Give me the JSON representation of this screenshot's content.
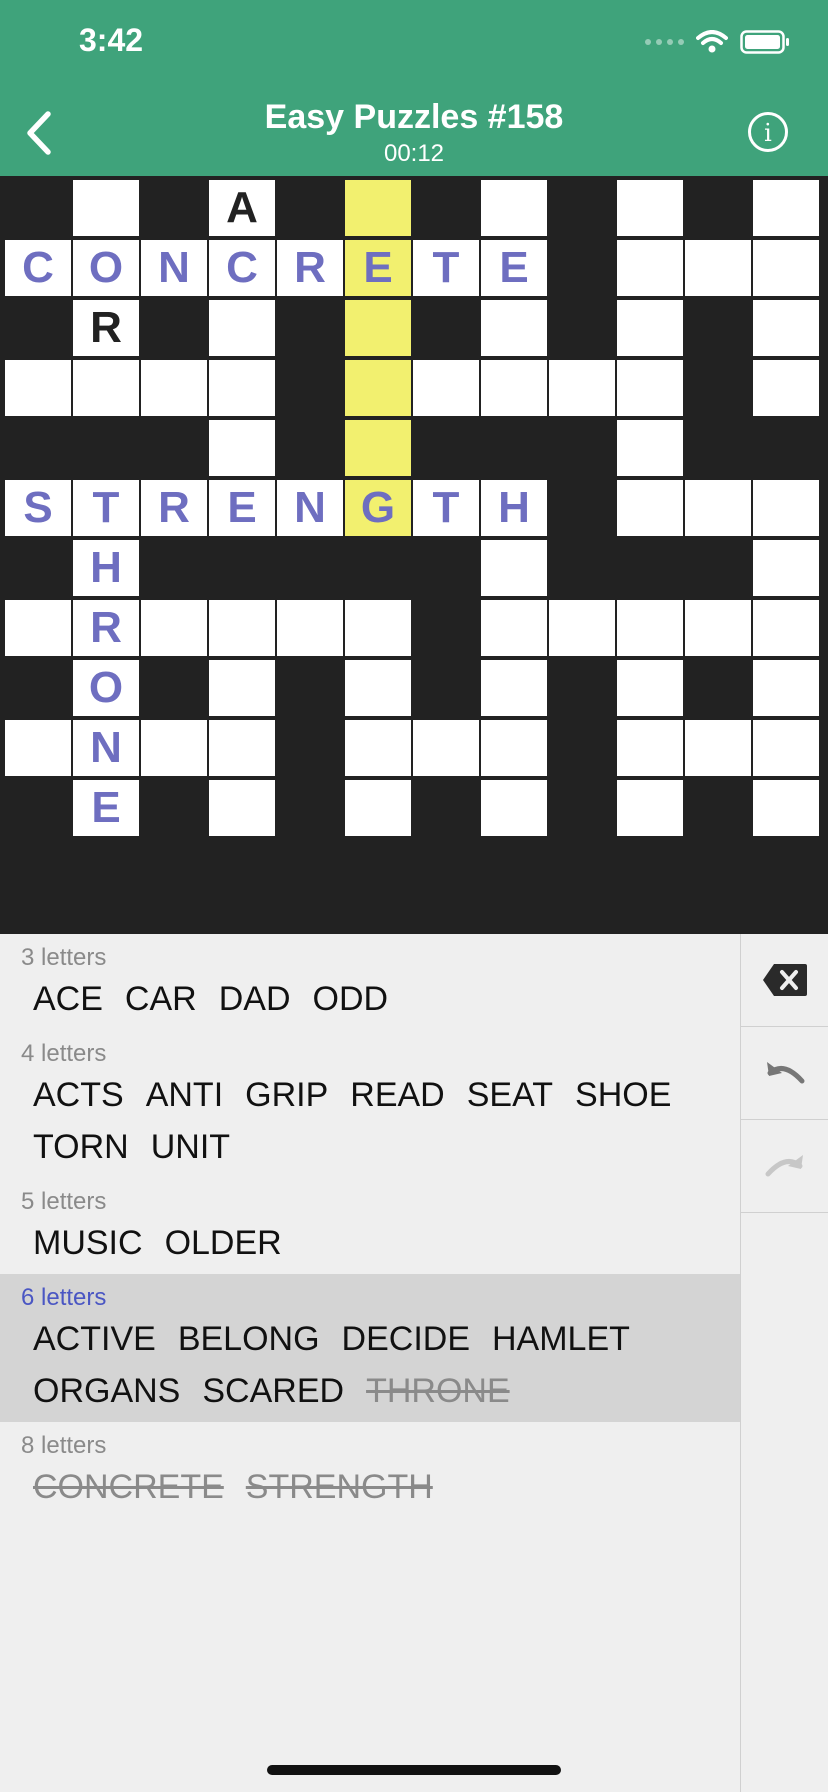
{
  "status_bar": {
    "time": "3:42"
  },
  "header": {
    "title": "Easy Puzzles #158",
    "timer": "00:12"
  },
  "grid": {
    "rows": [
      [
        ".",
        "_",
        ".",
        "A",
        ".",
        "*",
        ".",
        "_",
        ".",
        "_",
        ".",
        "_"
      ],
      [
        "C",
        "O",
        "N",
        "C",
        "R",
        "E",
        "T",
        "E",
        ".",
        "_",
        "_",
        "_"
      ],
      [
        ".",
        "R",
        ".",
        "_",
        ".",
        "*",
        ".",
        "_",
        ".",
        "_",
        ".",
        "_"
      ],
      [
        "_",
        "_",
        "_",
        "_",
        ".",
        "*",
        "_",
        "_",
        "_",
        "_",
        ".",
        "_"
      ],
      [
        ".",
        ".",
        ".",
        "_",
        ".",
        "*",
        ".",
        ".",
        ".",
        "_",
        ".",
        "."
      ],
      [
        "S",
        "T",
        "R",
        "E",
        "N",
        "G",
        "T",
        "H",
        ".",
        "_",
        "_",
        "_"
      ],
      [
        ".",
        "H",
        ".",
        ".",
        ".",
        ".",
        ".",
        "_",
        ".",
        ".",
        ".",
        "_"
      ],
      [
        "_",
        "R",
        "_",
        "_",
        "_",
        "_",
        ".",
        "_",
        "_",
        "_",
        "_",
        "_"
      ],
      [
        ".",
        "O",
        ".",
        "_",
        ".",
        "_",
        ".",
        "_",
        ".",
        "_",
        ".",
        "_"
      ],
      [
        "_",
        "N",
        "_",
        "_",
        ".",
        "_",
        "_",
        "_",
        ".",
        "_",
        "_",
        "_"
      ],
      [
        ".",
        "E",
        ".",
        "_",
        ".",
        "_",
        ".",
        "_",
        ".",
        "_",
        ".",
        "_"
      ]
    ],
    "given_letters": [
      "0,3",
      "2,1"
    ],
    "highlight_color": "#f2f06f",
    "letter_color": "#6e6ec0"
  },
  "word_groups": [
    {
      "label": "3 letters",
      "lines": [
        [
          {
            "w": "ACE"
          },
          {
            "w": "CAR"
          },
          {
            "w": "DAD"
          },
          {
            "w": "ODD"
          }
        ]
      ]
    },
    {
      "label": "4 letters",
      "lines": [
        [
          {
            "w": "ACTS"
          },
          {
            "w": "ANTI"
          },
          {
            "w": "GRIP"
          },
          {
            "w": "READ"
          },
          {
            "w": "SEAT"
          },
          {
            "w": "SHOE"
          }
        ],
        [
          {
            "w": "TORN"
          },
          {
            "w": "UNIT"
          }
        ]
      ]
    },
    {
      "label": "5 letters",
      "lines": [
        [
          {
            "w": "MUSIC"
          },
          {
            "w": "OLDER"
          }
        ]
      ]
    },
    {
      "label": "6 letters",
      "active": true,
      "lines": [
        [
          {
            "w": "ACTIVE"
          },
          {
            "w": "BELONG"
          },
          {
            "w": "DECIDE"
          },
          {
            "w": "HAMLET"
          }
        ],
        [
          {
            "w": "ORGANS"
          },
          {
            "w": "SCARED"
          },
          {
            "w": "THRONE",
            "used": true
          }
        ]
      ]
    },
    {
      "label": "8 letters",
      "lines": [
        [
          {
            "w": "CONCRETE",
            "used": true
          },
          {
            "w": "STRENGTH",
            "used": true
          }
        ]
      ]
    }
  ],
  "side_buttons": [
    {
      "name": "delete-button",
      "icon": "backspace-x-icon"
    },
    {
      "name": "undo-button",
      "icon": "undo-icon"
    },
    {
      "name": "redo-button",
      "icon": "redo-icon",
      "disabled": true
    }
  ],
  "colors": {
    "header": "#3fa37b",
    "active_group": "#d4d4d4",
    "active_label": "#4a56c3"
  }
}
